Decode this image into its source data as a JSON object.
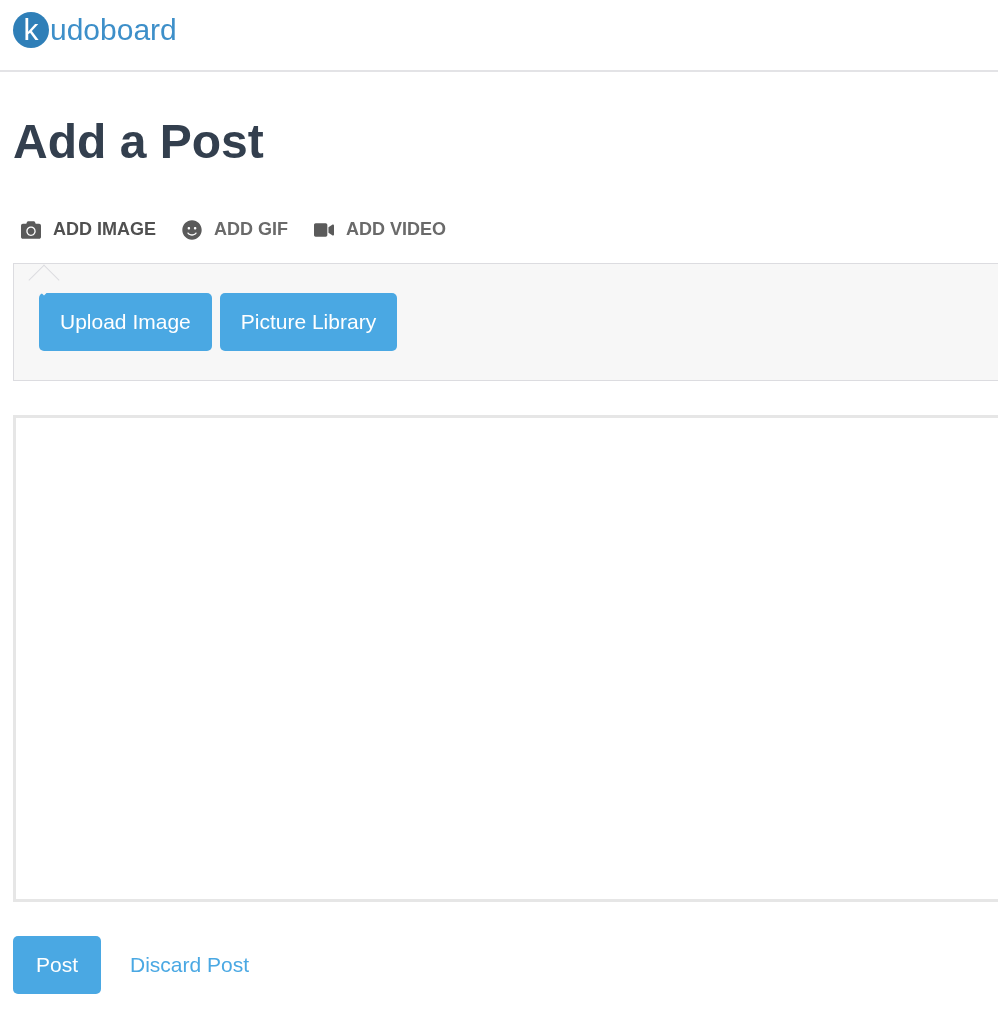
{
  "logo": {
    "badge": "k",
    "text": "udoboard"
  },
  "title": "Add a Post",
  "tabs": [
    {
      "kind": "camera",
      "label": "ADD IMAGE",
      "selected": true
    },
    {
      "kind": "smile",
      "label": "ADD GIF",
      "selected": false
    },
    {
      "kind": "video",
      "label": "ADD VIDEO",
      "selected": false
    }
  ],
  "panel_buttons": [
    "Upload Image",
    "Picture Library"
  ],
  "actions": {
    "primary": "Post",
    "link": "Discard Post"
  }
}
